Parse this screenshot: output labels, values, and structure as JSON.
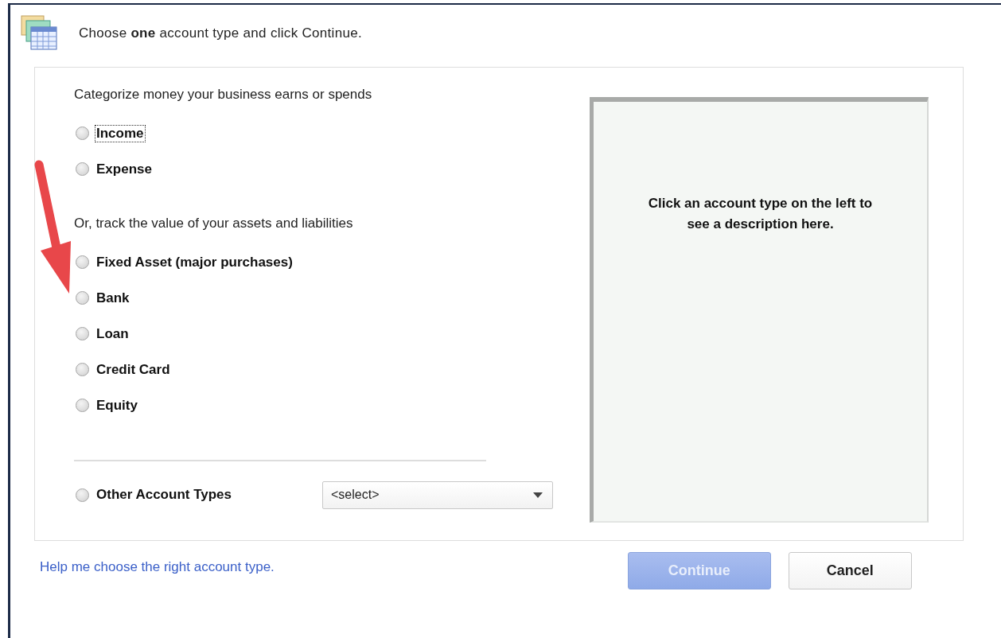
{
  "dialog": {
    "instruction": "Choose **one** account type and click Continue."
  },
  "groups": [
    {
      "heading": "Categorize money your business earns or spends",
      "options": [
        {
          "label": "Income",
          "selected": false,
          "focused": true
        },
        {
          "label": "Expense",
          "selected": false,
          "focused": false
        }
      ]
    },
    {
      "heading": "Or, track the value of your assets and liabilities",
      "options": [
        {
          "label": "Fixed Asset (major purchases)",
          "selected": false,
          "focused": false
        },
        {
          "label": "Bank",
          "selected": false,
          "focused": false
        },
        {
          "label": "Loan",
          "selected": false,
          "focused": false
        },
        {
          "label": "Credit Card",
          "selected": false,
          "focused": false
        },
        {
          "label": "Equity",
          "selected": false,
          "focused": false
        }
      ]
    }
  ],
  "other": {
    "label": "Other Account Types",
    "selected": false,
    "dropdown": {
      "value": "<select>"
    }
  },
  "description": "Click an account type on the left to see a description here.",
  "help_link": "Help me choose the right account type.",
  "buttons": [
    {
      "label": "Continue",
      "disabled": true
    },
    {
      "label": "Cancel",
      "disabled": false
    }
  ]
}
